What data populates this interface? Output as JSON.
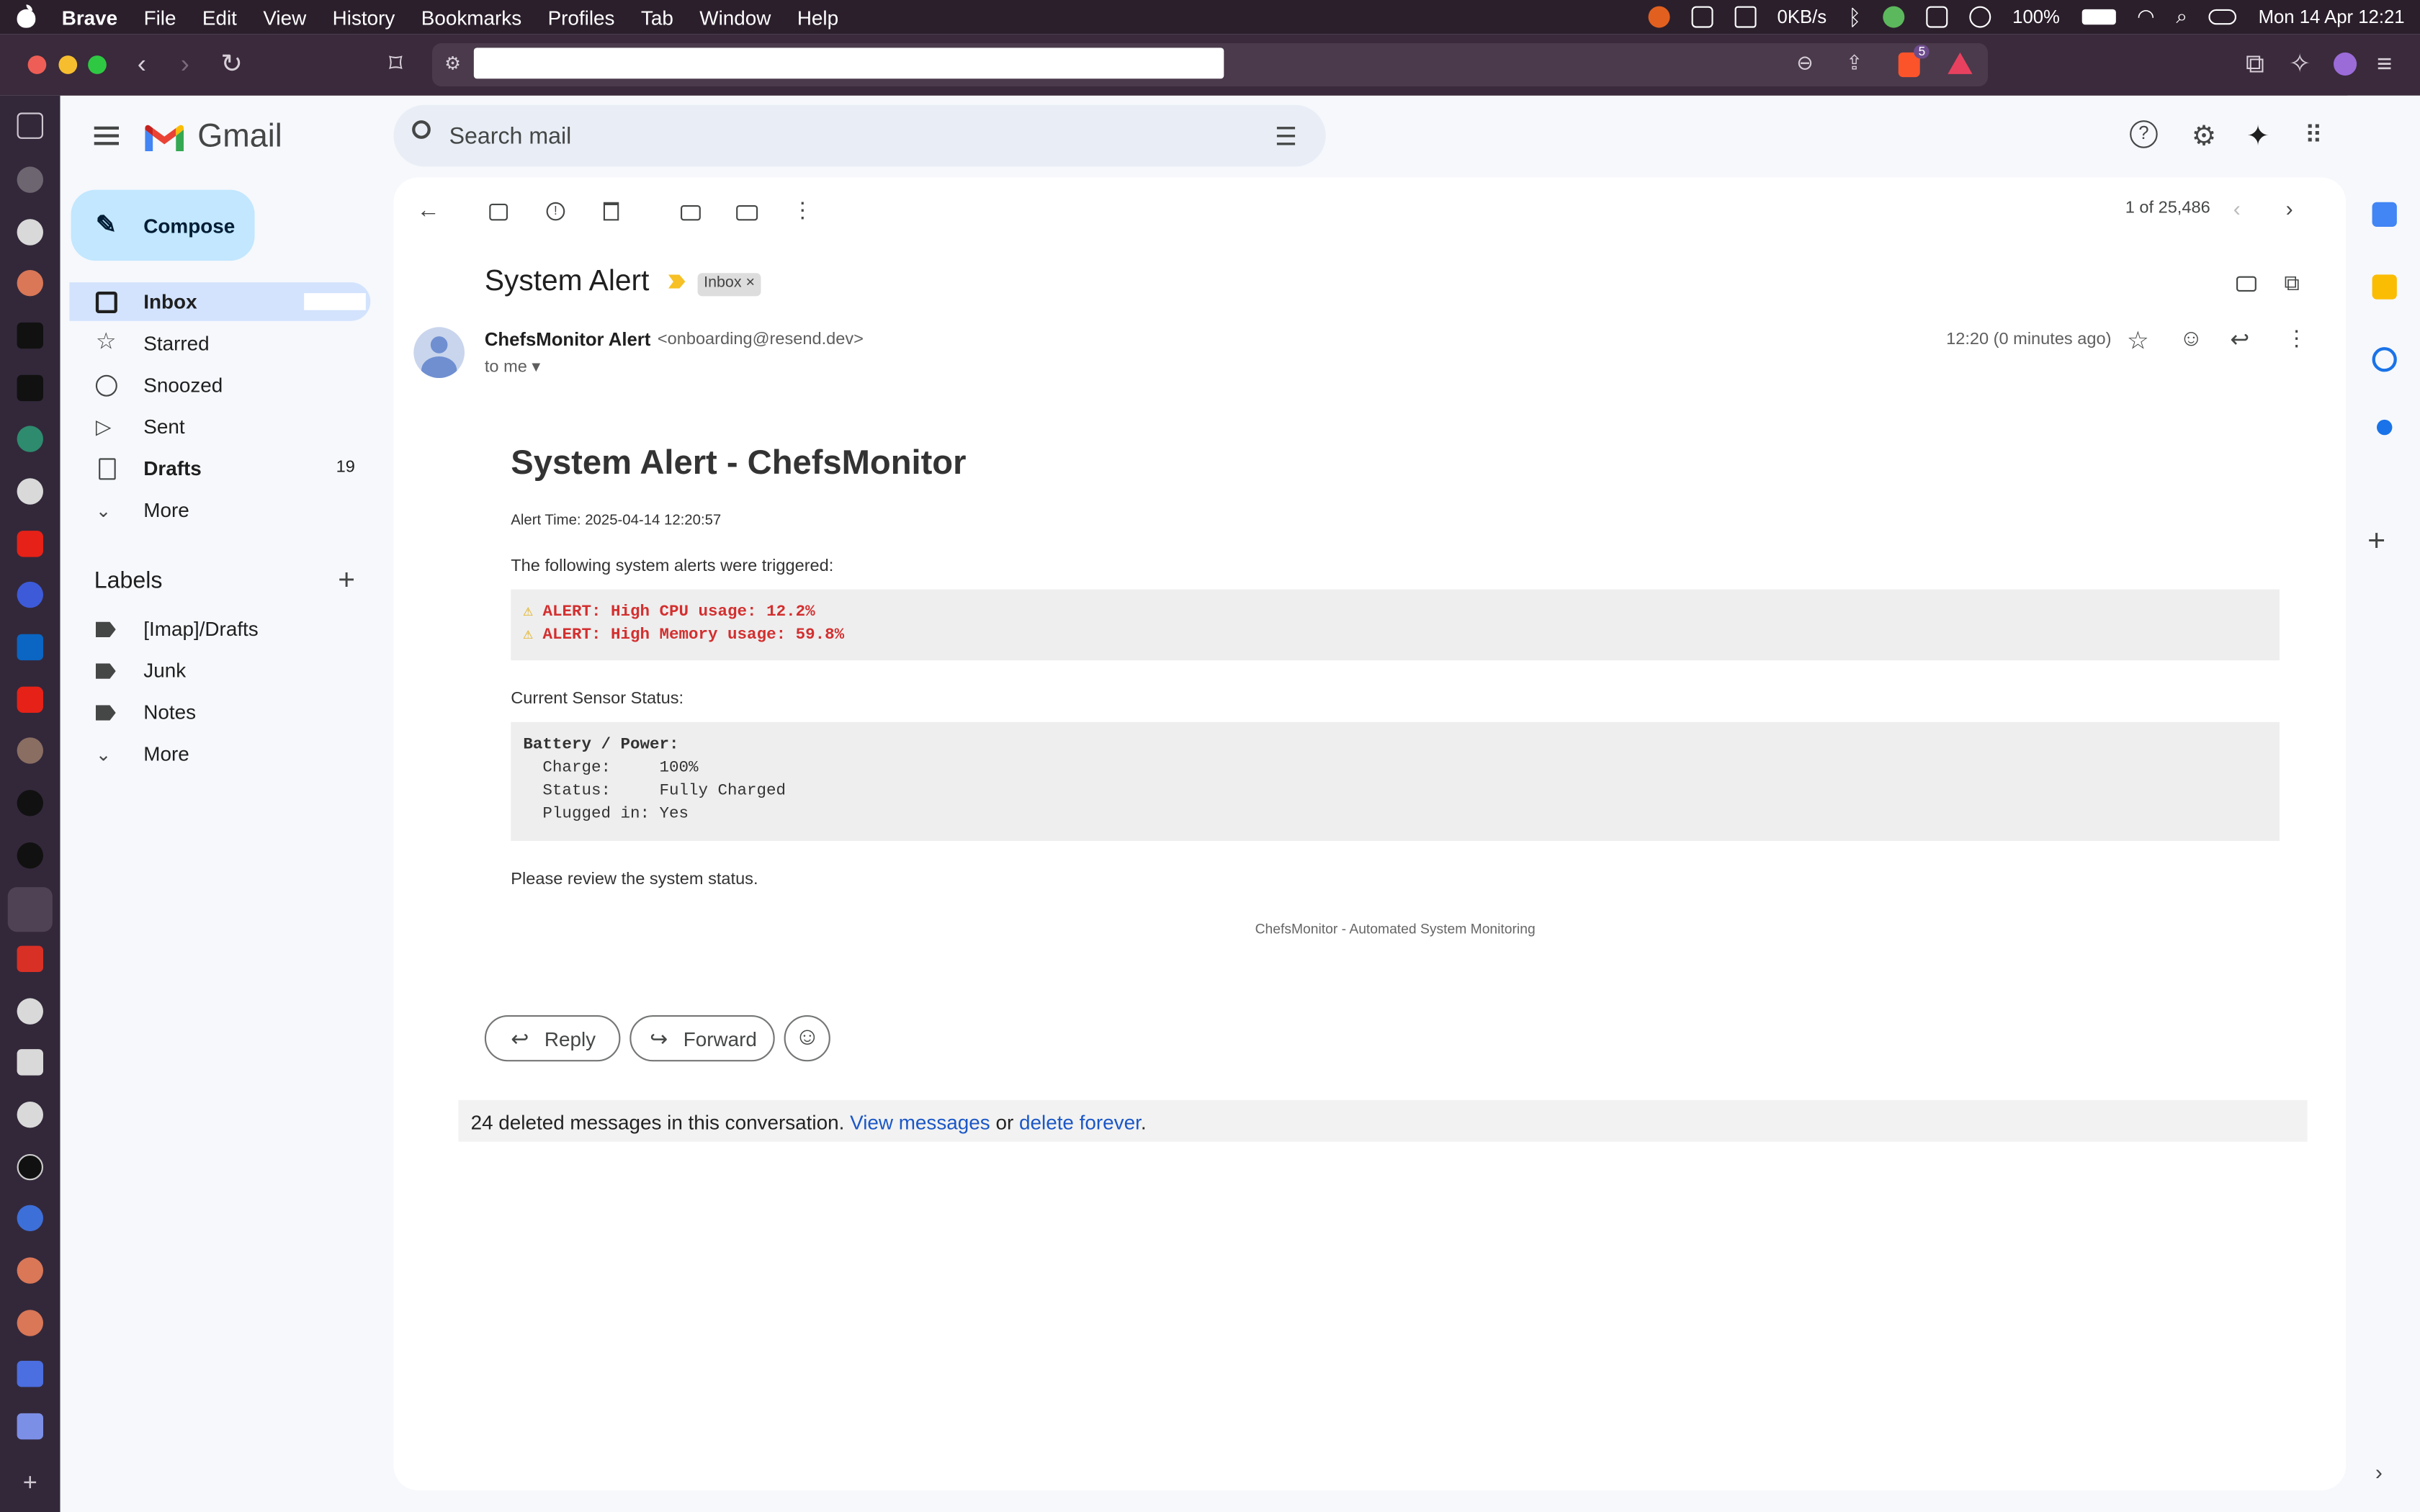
{
  "menubar": {
    "app": "Brave",
    "items": [
      "File",
      "Edit",
      "View",
      "History",
      "Bookmarks",
      "Profiles",
      "Tab",
      "Window",
      "Help"
    ],
    "network": "0KB/s",
    "battery": "100%",
    "datetime": "Mon 14 Apr  12:21"
  },
  "browser": {
    "shield_badge": "5"
  },
  "gmail": {
    "brand": "Gmail",
    "search_placeholder": "Search mail",
    "compose": "Compose",
    "nav": [
      {
        "label": "Inbox",
        "count": ""
      },
      {
        "label": "Starred",
        "count": ""
      },
      {
        "label": "Snoozed",
        "count": ""
      },
      {
        "label": "Sent",
        "count": ""
      },
      {
        "label": "Drafts",
        "count": "19"
      },
      {
        "label": "More",
        "count": ""
      }
    ],
    "labels_title": "Labels",
    "labels": [
      "[Imap]/Drafts",
      "Junk",
      "Notes",
      "More"
    ],
    "pagination": "1 of 25,486"
  },
  "email": {
    "subject": "System Alert",
    "chip": "Inbox",
    "sender_name": "ChefsMonitor Alert",
    "sender_email": "<onboarding@resend.dev>",
    "to": "to me",
    "time": "12:20 (0 minutes ago)",
    "heading": "System Alert - ChefsMonitor",
    "alert_time": "Alert Time: 2025-04-14 12:20:57",
    "intro": "The following system alerts were triggered:",
    "alerts": [
      "ALERT: High CPU usage: 12.2%",
      "ALERT: High Memory usage: 59.8%"
    ],
    "sensor_title": "Current Sensor Status:",
    "sensor_head": "Battery / Power:",
    "sensor_lines": [
      "  Charge:     100%",
      "  Status:     Fully Charged",
      "  Plugged in: Yes"
    ],
    "review": "Please review the system status.",
    "footer": "ChefsMonitor - Automated System Monitoring",
    "reply": "Reply",
    "forward": "Forward",
    "deleted_text": "24 deleted messages in this conversation.",
    "view_link": "View messages",
    "or": "or",
    "delete_link": "delete forever",
    "period": "."
  }
}
